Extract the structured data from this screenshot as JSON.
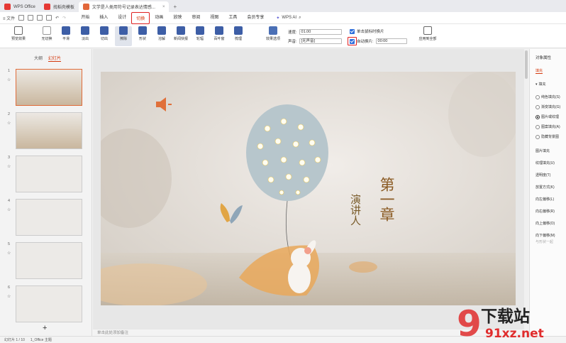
{
  "tabs": [
    {
      "label": "WPS Office",
      "color": "#e53935"
    },
    {
      "label": "找稻壳模板",
      "color": "#e53935"
    },
    {
      "label": "文学是人类用符号记录表达情感...",
      "color": "#e2673a"
    }
  ],
  "new_tab": "+",
  "menu": {
    "file": "≡ 文件",
    "items": [
      "开始",
      "插入",
      "设计",
      "切换",
      "动画",
      "放映",
      "审阅",
      "视图",
      "工具",
      "会员专享"
    ],
    "active_index": 3,
    "wps_ai": "WPS AI"
  },
  "ribbon": {
    "preview": "预览效果",
    "effects": [
      "无切换",
      "平滑",
      "淡出",
      "切出",
      "擦除",
      "形状",
      "溶解",
      "新闻快报",
      "轮辐",
      "百叶窗",
      "梳理"
    ],
    "effect_options": "效果选项",
    "speed_label": "速度:",
    "speed_value": "01.00",
    "sound_label": "声音:",
    "sound_value": "[无声音]",
    "on_click_label": "单击鼠标时换片",
    "auto_label": "自动换片:",
    "auto_value": "00:00",
    "apply_all": "应用到全部"
  },
  "left": {
    "outline_tab": "大纲",
    "slides_tab": "幻灯片",
    "add": "+"
  },
  "slides": [
    {
      "num": "1"
    },
    {
      "num": "2"
    },
    {
      "num": "3"
    },
    {
      "num": "4"
    },
    {
      "num": "5"
    },
    {
      "num": "6"
    }
  ],
  "slide": {
    "title": "第一章",
    "subtitle": "演讲人"
  },
  "notes_placeholder": "单击此处添加备注",
  "right": {
    "title": "对象属性",
    "section": "填充",
    "fill": "填充",
    "options": [
      "纯色填充(S)",
      "渐变填充(G)",
      "图片或纹理",
      "图案填充(A)",
      "隐藏背景图"
    ],
    "selected_option": 2,
    "extra": [
      "图片填充",
      "纹理填充(U)",
      "透明度(T)",
      "放置方式(K)",
      "向左偏移(L)",
      "向右偏移(R)",
      "向上偏移(O)",
      "向下偏移(M)"
    ],
    "rotate": "与形状一起"
  },
  "status": {
    "page": "幻灯片 1 / 10",
    "theme": "1_Office 主题"
  },
  "watermark": {
    "brand": "下载站",
    "url": "91xz.net"
  },
  "colors": {
    "accent": "#d4380d",
    "highlight": "#e02020",
    "selected_blue": "#2f6fdc"
  }
}
